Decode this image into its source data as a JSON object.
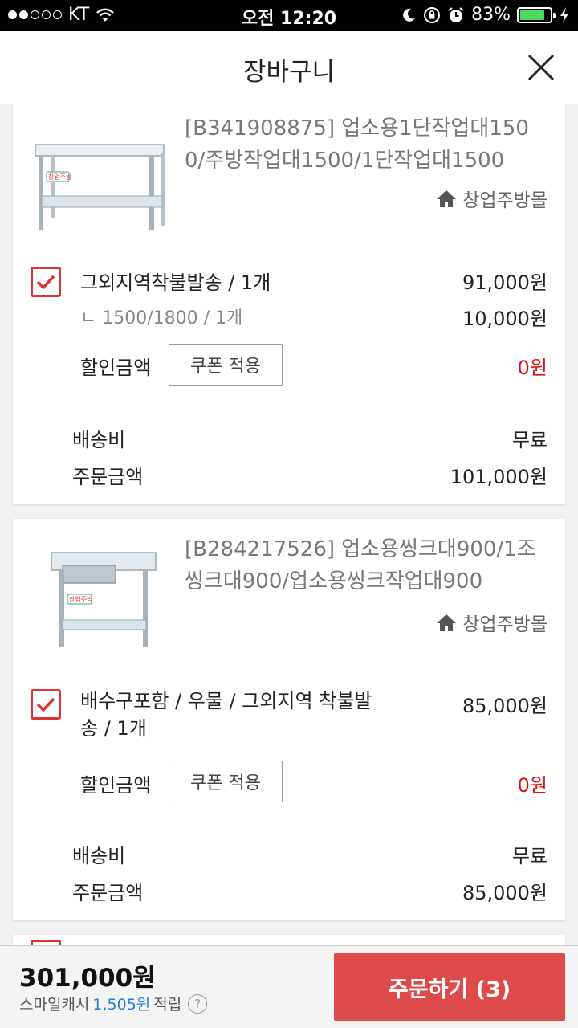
{
  "status": {
    "carrier": "KT",
    "time": "오전 12:20",
    "battery": "83%",
    "battery_level": 0.83
  },
  "header": {
    "title": "장바구니"
  },
  "items": [
    {
      "name": "[B341908875] 업소용1단작업대1500/주방작업대1500/1단작업대1500",
      "shop": "창업주방몰",
      "option": "그외지역착불발송 / 1개",
      "option_price": "91,000원",
      "sub_option": "ㄴ 1500/1800 / 1개",
      "sub_price": "10,000원",
      "discount_label": "할인금액",
      "coupon_label": "쿠폰 적용",
      "discount_value": "0원",
      "shipping_label": "배송비",
      "shipping_value": "무료",
      "order_label": "주문금액",
      "order_value": "101,000원"
    },
    {
      "name": "[B284217526] 업소용씽크대900/1조씽크대900/업소용씽크작업대900",
      "shop": "창업주방몰",
      "option": "배수구포함 / 우물 / 그외지역 착불발송 / 1개",
      "option_price": "85,000원",
      "discount_label": "할인금액",
      "coupon_label": "쿠폰 적용",
      "discount_value": "0원",
      "shipping_label": "배송비",
      "shipping_value": "무료",
      "order_label": "주문금액",
      "order_value": "85,000원"
    }
  ],
  "footer": {
    "total": "301,000원",
    "cash_label": "스마일캐시",
    "cash_amount": "1,505원",
    "cash_suffix": "적립",
    "order_button": "주문하기 (3)"
  },
  "colors": {
    "accent": "#de4a4a",
    "checkbox": "#d33333",
    "link": "#2a7fd0"
  }
}
